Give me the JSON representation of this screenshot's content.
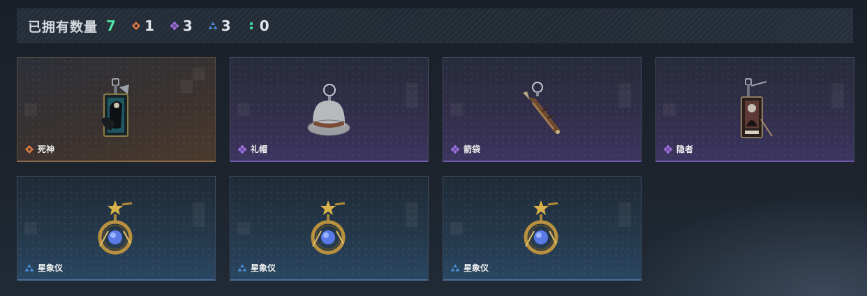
{
  "header": {
    "title": "已拥有数量",
    "total": "7",
    "counts": [
      {
        "rarity": "orange",
        "icon": "orange-diamond-icon",
        "color": "#e07a45",
        "value": "1"
      },
      {
        "rarity": "purple",
        "icon": "purple-diamond-icon",
        "color": "#9b6ddc",
        "value": "3"
      },
      {
        "rarity": "blue",
        "icon": "blue-triangle-icon",
        "color": "#4a8fd8",
        "value": "3"
      },
      {
        "rarity": "green",
        "icon": "green-dots-icon",
        "color": "#3fd9a0",
        "value": "0"
      }
    ]
  },
  "items": [
    {
      "name": "死神",
      "rarity": "orange",
      "art": "reaper-card-pendant"
    },
    {
      "name": "礼帽",
      "rarity": "purple",
      "art": "top-hat-pendant"
    },
    {
      "name": "箭袋",
      "rarity": "purple",
      "art": "quiver-pendant"
    },
    {
      "name": "隐者",
      "rarity": "purple",
      "art": "hermit-card-pendant"
    },
    {
      "name": "星象仪",
      "rarity": "blue",
      "art": "astrolabe-pendant"
    },
    {
      "name": "星象仪",
      "rarity": "blue",
      "art": "astrolabe-pendant"
    },
    {
      "name": "星象仪",
      "rarity": "blue",
      "art": "astrolabe-pendant"
    }
  ],
  "colors": {
    "orange": "#e07a45",
    "purple": "#9b6ddc",
    "blue": "#4a8fd8",
    "green": "#3fd9a0",
    "total": "#4fe3a4"
  }
}
